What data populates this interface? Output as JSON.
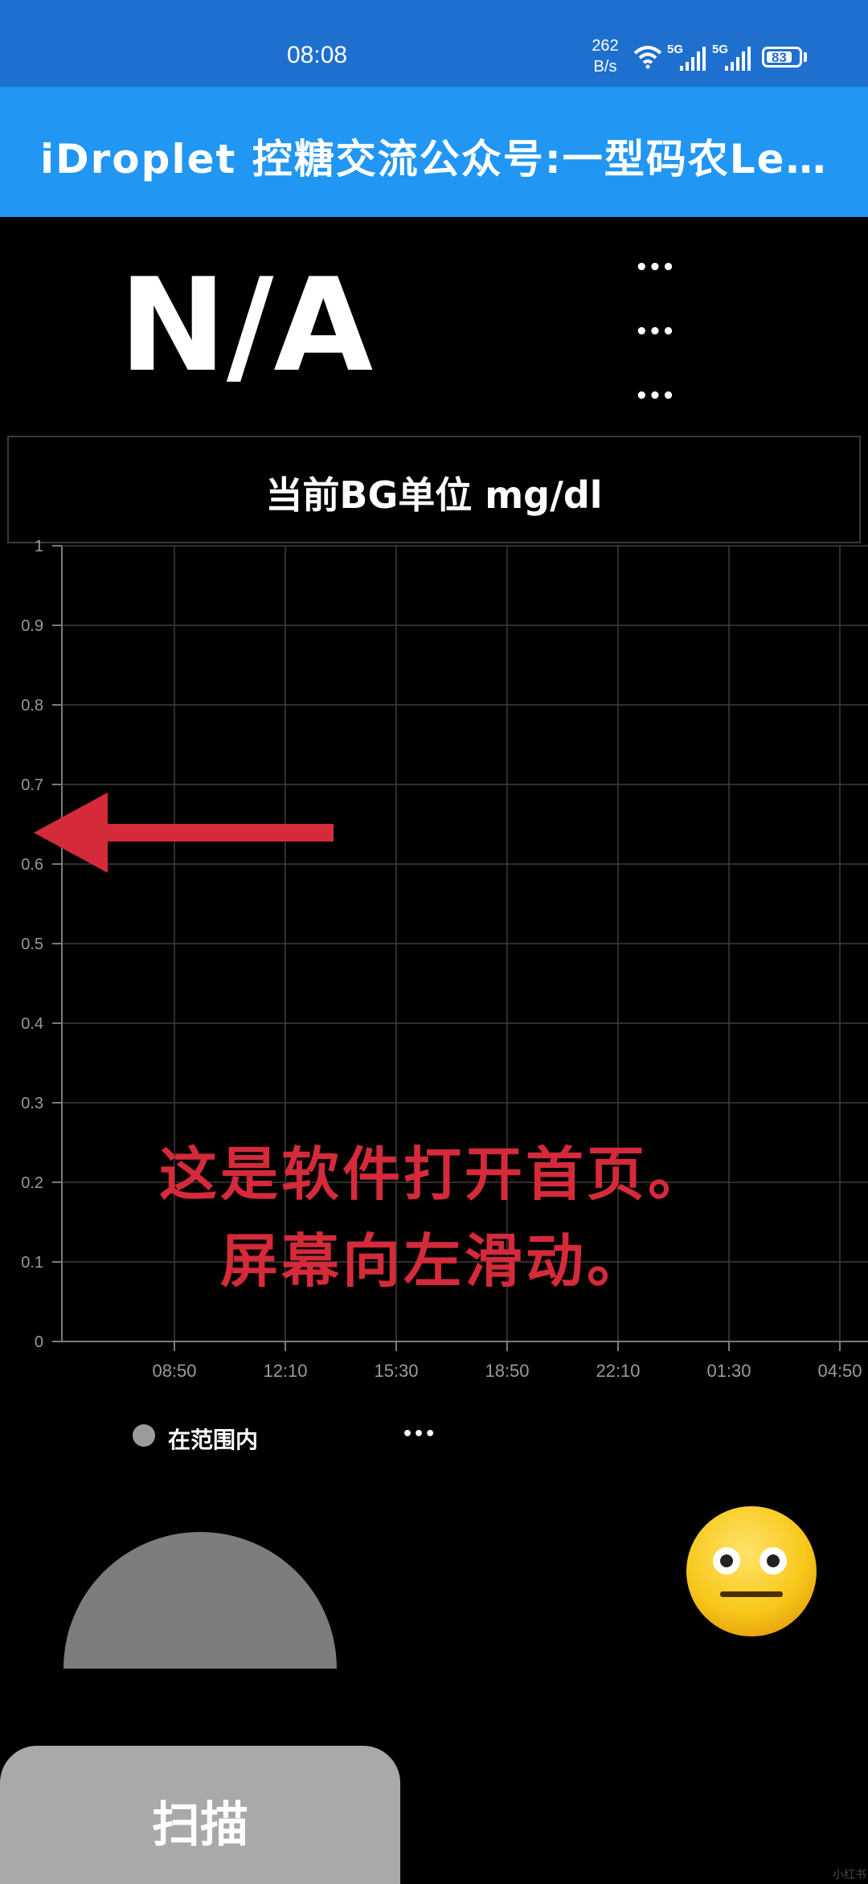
{
  "status_bar": {
    "time": "08:08",
    "net_speed_value": "262",
    "net_speed_unit": "B/s",
    "signal_1_label": "5G",
    "signal_2_label": "5G",
    "battery": "83"
  },
  "app_bar": {
    "title": "iDroplet 控糖交流公众号:一型码农Le…"
  },
  "reading": {
    "value": "N/A",
    "more_1": "•••",
    "more_2": "•••",
    "more_3": "•••"
  },
  "unit": {
    "label": "当前BG单位 mg/dl"
  },
  "chart_data": {
    "type": "line",
    "x": [
      "08:50",
      "12:10",
      "15:30",
      "18:50",
      "22:10",
      "01:30",
      "04:50"
    ],
    "series": [],
    "ylim": [
      0,
      1
    ],
    "yticks": [
      "0",
      "0.1",
      "0.2",
      "0.3",
      "0.4",
      "0.5",
      "0.6",
      "0.7",
      "0.8",
      "0.9",
      "1"
    ],
    "grid": true,
    "grid_color": "#3d3d3d",
    "axis_color": "#7a7a7a"
  },
  "annotation": {
    "line1": "这是软件打开首页。",
    "line2": "屏幕向左滑动。",
    "arrow_color": "#d42a3a",
    "arrow_direction": "left"
  },
  "legend": {
    "label": "在范围内",
    "dot_color": "#9b9b9b",
    "more": "•••"
  },
  "status_face": {
    "icon": "neutral-face-icon"
  },
  "scan": {
    "label": "扫描"
  },
  "watermark": "小红书"
}
